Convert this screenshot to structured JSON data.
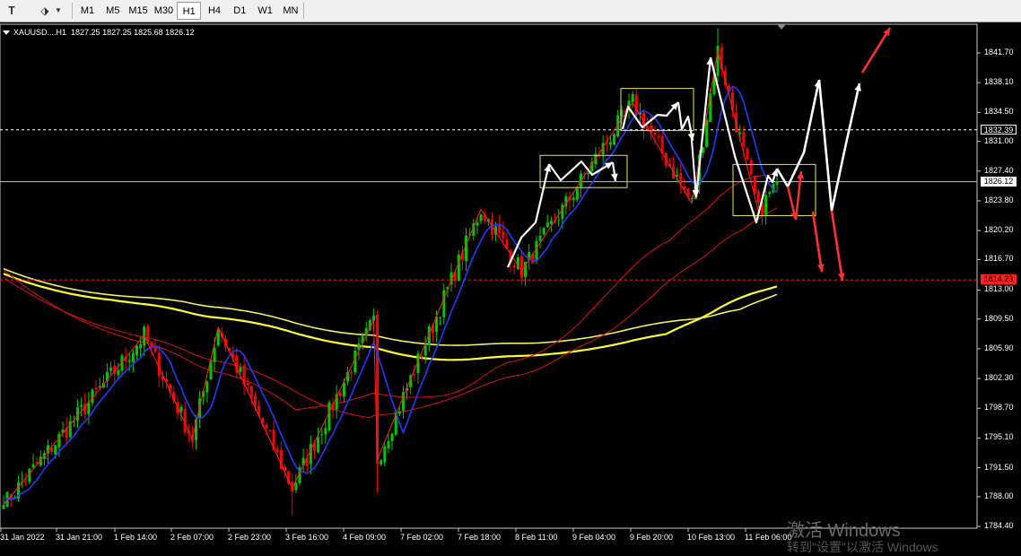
{
  "toolbar": {
    "timeframes": [
      "M1",
      "M5",
      "M15",
      "M30",
      "H1",
      "H4",
      "D1",
      "W1",
      "MN"
    ],
    "active_timeframe": "H1",
    "icons": [
      "text-tool-icon",
      "objects-icon",
      "dropdown-arrow-icon"
    ]
  },
  "chart_header": {
    "symbol": "XAUUSD....H1",
    "ohlc": "1827.25 1827.25 1825.68 1826.12"
  },
  "watermark": {
    "line1": "激活 Windows",
    "line2": "转到\"设置\"以激活 Windows"
  },
  "colors": {
    "background": "#000000",
    "bull_candle": "#00c800",
    "bear_candle": "#ff0000",
    "fast_ma": "#1e3cff",
    "slow_ma": "#ffff33",
    "zigzag": "#ff2020",
    "forecast_up": "#ffffff",
    "forecast_down": "#ff3030",
    "box": "#e6e64a"
  },
  "chart_data": {
    "type": "candlestick",
    "y_ticks": [
      "1841.70",
      "1838.10",
      "1834.50",
      "1831.00",
      "1827.40",
      "1823.80",
      "1820.20",
      "1816.70",
      "1813.00",
      "1809.50",
      "1805.90",
      "1802.30",
      "1798.70",
      "1795.10",
      "1791.50",
      "1788.00",
      "1784.40"
    ],
    "x_ticks": [
      "31 Jan 2022",
      "31 Jan 21:00",
      "1 Feb 14:00",
      "2 Feb 07:00",
      "2 Feb 23:00",
      "3 Feb 16:00",
      "4 Feb 09:00",
      "7 Feb 02:00",
      "7 Feb 18:00",
      "8 Feb 11:00",
      "9 Feb 04:00",
      "9 Feb 20:00",
      "10 Feb 13:00",
      "11 Feb 06:00"
    ],
    "ylim": [
      1784.4,
      1841.7
    ],
    "current_price": "1826.12",
    "horizontal_levels": [
      {
        "value": "1832.39",
        "style": "dashed",
        "color": "#ffffff"
      },
      {
        "value": "1826.12",
        "style": "solid",
        "color": "#c0c0c0"
      },
      {
        "value": "1814.23",
        "style": "dashed",
        "color": "#ff2020"
      }
    ],
    "zigzag_prices": [
      1787,
      1807.5,
      1795,
      1808.5,
      1789,
      1809.3,
      1792.5,
      1822.8,
      1815.3,
      1835.7,
      1823.5,
      1842.0,
      1822.5
    ],
    "boxes": [
      {
        "from": "8 Feb 11:00",
        "to": "9 Feb 04:00",
        "high": 1829.3,
        "low": 1825.4
      },
      {
        "from": "9 Feb 20:00",
        "to": "10 Feb 13:00",
        "high": 1837.4,
        "low": 1832.3
      },
      {
        "from": "11 Feb 06:00",
        "to": "11 Feb 06:00",
        "high": 1828.2,
        "low": 1822.0
      }
    ]
  }
}
